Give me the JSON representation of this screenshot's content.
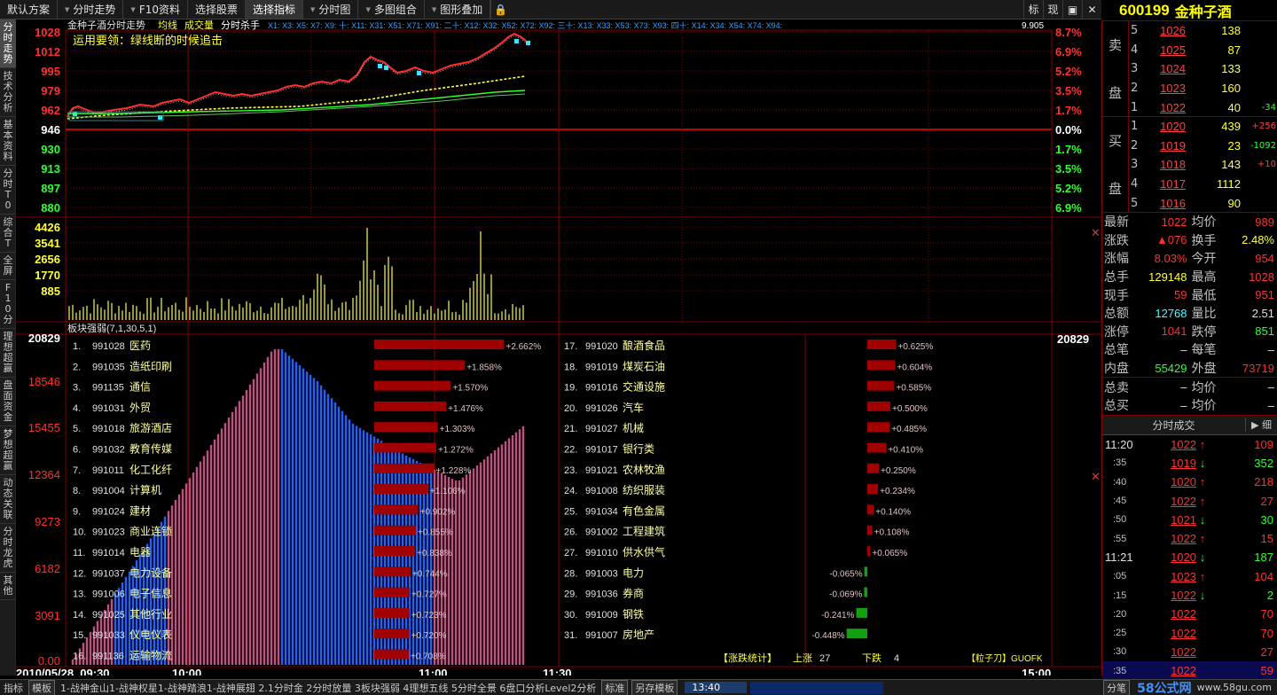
{
  "toolbar": {
    "items": [
      "默认方案",
      "分时走势",
      "F10资料",
      "选择股票",
      "选择指标",
      "分时图",
      "多图组合",
      "图形叠加"
    ],
    "right_buttons": [
      "标",
      "现",
      "",
      ""
    ]
  },
  "stock": {
    "code": "600199",
    "name": "金种子酒"
  },
  "left_tabs": [
    "分时走势",
    "技术分析",
    "基本资料",
    "分时T0",
    "综合T",
    "全屏",
    "F10分",
    "理想超赢",
    "盘面资金",
    "梦想超赢",
    "动态关联",
    "分时龙虎",
    "其他"
  ],
  "intraday": {
    "title": "金种子酒分时走势",
    "indicators": [
      "均线",
      "成交量",
      "分时杀手"
    ],
    "ma_legend": "X1: X3: X5: X7: X9: 十: X11: X31: X51: X71: X91: 二十: X12: X32: X52: X72: X92: 三十: X13: X33: X53: X73: X93: 四十: X14: X34: X54: X74: X94:",
    "last_value": "9.905",
    "note": "运用要领：绿线断的时候追击",
    "price_left": [
      "1028",
      "1012",
      "995",
      "979",
      "962",
      "946",
      "930",
      "913",
      "897",
      "880"
    ],
    "pct_right": [
      "8.7%",
      "6.9%",
      "5.2%",
      "3.5%",
      "1.7%",
      "0.0%",
      "1.7%",
      "3.5%",
      "5.2%",
      "6.9%"
    ],
    "vol_left": [
      "4426",
      "3541",
      "2656",
      "1770",
      "885"
    ]
  },
  "sector": {
    "header": "板块强弱(7,1,30,5,1)",
    "scale_left": [
      "20829",
      "18546",
      "15455",
      "12364",
      "9273",
      "6182",
      "3091",
      "0.00"
    ],
    "scale_right": "20829",
    "items_left": [
      {
        "rank": "1.",
        "code": "991028",
        "name": "医药",
        "pct": "+2.662%",
        "v": 2.662
      },
      {
        "rank": "2.",
        "code": "991035",
        "name": "造纸印刷",
        "pct": "+1.858%",
        "v": 1.858
      },
      {
        "rank": "3.",
        "code": "991135",
        "name": "通信",
        "pct": "+1.570%",
        "v": 1.57
      },
      {
        "rank": "4.",
        "code": "991031",
        "name": "外贸",
        "pct": "+1.476%",
        "v": 1.476
      },
      {
        "rank": "5.",
        "code": "991018",
        "name": "旅游酒店",
        "pct": "+1.303%",
        "v": 1.303
      },
      {
        "rank": "6.",
        "code": "991032",
        "name": "教育传媒",
        "pct": "+1.272%",
        "v": 1.272
      },
      {
        "rank": "7.",
        "code": "991011",
        "name": "化工化纤",
        "pct": "+1.228%",
        "v": 1.228
      },
      {
        "rank": "8.",
        "code": "991004",
        "name": "计算机",
        "pct": "+1.106%",
        "v": 1.106
      },
      {
        "rank": "9.",
        "code": "991024",
        "name": "建材",
        "pct": "+0.902%",
        "v": 0.902
      },
      {
        "rank": "10.",
        "code": "991023",
        "name": "商业连锁",
        "pct": "+0.855%",
        "v": 0.855
      },
      {
        "rank": "11.",
        "code": "991014",
        "name": "电器",
        "pct": "+0.838%",
        "v": 0.838
      },
      {
        "rank": "12.",
        "code": "991037",
        "name": "电力设备",
        "pct": "+0.744%",
        "v": 0.744
      },
      {
        "rank": "13.",
        "code": "991006",
        "name": "电子信息",
        "pct": "+0.727%",
        "v": 0.727
      },
      {
        "rank": "14.",
        "code": "991025",
        "name": "其他行业",
        "pct": "+0.723%",
        "v": 0.723
      },
      {
        "rank": "15.",
        "code": "991033",
        "name": "仪电仪表",
        "pct": "+0.720%",
        "v": 0.72
      },
      {
        "rank": "16.",
        "code": "991136",
        "name": "运输物流",
        "pct": "+0.708%",
        "v": 0.708
      }
    ],
    "items_right": [
      {
        "rank": "17.",
        "code": "991020",
        "name": "酿酒食品",
        "pct": "+0.625%",
        "v": 0.625
      },
      {
        "rank": "18.",
        "code": "991019",
        "name": "煤炭石油",
        "pct": "+0.604%",
        "v": 0.604
      },
      {
        "rank": "19.",
        "code": "991016",
        "name": "交通设施",
        "pct": "+0.585%",
        "v": 0.585
      },
      {
        "rank": "20.",
        "code": "991026",
        "name": "汽车",
        "pct": "+0.500%",
        "v": 0.5
      },
      {
        "rank": "21.",
        "code": "991027",
        "name": "机械",
        "pct": "+0.485%",
        "v": 0.485
      },
      {
        "rank": "22.",
        "code": "991017",
        "name": "银行类",
        "pct": "+0.410%",
        "v": 0.41
      },
      {
        "rank": "23.",
        "code": "991021",
        "name": "农林牧渔",
        "pct": "+0.250%",
        "v": 0.25
      },
      {
        "rank": "24.",
        "code": "991008",
        "name": "纺织服装",
        "pct": "+0.234%",
        "v": 0.234
      },
      {
        "rank": "25.",
        "code": "991034",
        "name": "有色金属",
        "pct": "+0.140%",
        "v": 0.14
      },
      {
        "rank": "26.",
        "code": "991002",
        "name": "工程建筑",
        "pct": "+0.108%",
        "v": 0.108
      },
      {
        "rank": "27.",
        "code": "991010",
        "name": "供水供气",
        "pct": "+0.065%",
        "v": 0.065
      },
      {
        "rank": "28.",
        "code": "991003",
        "name": "电力",
        "pct": "-0.065%",
        "v": -0.065
      },
      {
        "rank": "29.",
        "code": "991036",
        "name": "券商",
        "pct": "-0.069%",
        "v": -0.069
      },
      {
        "rank": "30.",
        "code": "991009",
        "name": "钢铁",
        "pct": "-0.241%",
        "v": -0.241
      },
      {
        "rank": "31.",
        "code": "991007",
        "name": "房地产",
        "pct": "-0.448%",
        "v": -0.448
      }
    ],
    "stats_label": "【涨跌统计】",
    "up_label": "上涨",
    "up_count": "27",
    "down_label": "下跌",
    "down_count": "4",
    "brand_label": "【粒子刀】GUOFK"
  },
  "time_axis": {
    "date": "2010/05/28, 09:30",
    "ticks": [
      "10:00",
      "11:00",
      "11:30",
      "15:00"
    ]
  },
  "orderbook": {
    "ask_label": [
      "卖",
      "盘"
    ],
    "bid_label": [
      "买",
      "盘"
    ],
    "asks": [
      {
        "lvl": "5",
        "price": "1026",
        "vol": "138",
        "chg": ""
      },
      {
        "lvl": "4",
        "price": "1025",
        "vol": "87",
        "chg": ""
      },
      {
        "lvl": "3",
        "price": "1024",
        "vol": "133",
        "chg": ""
      },
      {
        "lvl": "2",
        "price": "1023",
        "vol": "160",
        "chg": ""
      },
      {
        "lvl": "1",
        "price": "1022",
        "vol": "40",
        "chg": "-34"
      }
    ],
    "bids": [
      {
        "lvl": "1",
        "price": "1020",
        "vol": "439",
        "chg": "+256"
      },
      {
        "lvl": "2",
        "price": "1019",
        "vol": "23",
        "chg": "-1092"
      },
      {
        "lvl": "3",
        "price": "1018",
        "vol": "143",
        "chg": "+10"
      },
      {
        "lvl": "4",
        "price": "1017",
        "vol": "1112",
        "chg": ""
      },
      {
        "lvl": "5",
        "price": "1016",
        "vol": "90",
        "chg": ""
      }
    ]
  },
  "quote": [
    {
      "k1": "最新",
      "v1": "1022",
      "c1": "red",
      "k2": "均价",
      "v2": "989",
      "c2": "red"
    },
    {
      "k1": "涨跌",
      "v1": "▲076",
      "c1": "red",
      "k2": "换手",
      "v2": "2.48%",
      "c2": "yel"
    },
    {
      "k1": "涨幅",
      "v1": "8.03%",
      "c1": "red",
      "k2": "今开",
      "v2": "954",
      "c2": "red"
    },
    {
      "k1": "总手",
      "v1": "129148",
      "c1": "yel",
      "k2": "最高",
      "v2": "1028",
      "c2": "red"
    },
    {
      "k1": "现手",
      "v1": "59",
      "c1": "red",
      "k2": "最低",
      "v2": "951",
      "c2": "red"
    },
    {
      "k1": "总额",
      "v1": "12768",
      "c1": "cyan",
      "k2": "量比",
      "v2": "2.51",
      "c2": "wht"
    },
    {
      "k1": "涨停",
      "v1": "1041",
      "c1": "red",
      "k2": "跌停",
      "v2": "851",
      "c2": "grn"
    },
    {
      "k1": "总笔",
      "v1": "–",
      "c1": "wht",
      "k2": "每笔",
      "v2": "–",
      "c2": "wht"
    },
    {
      "k1": "内盘",
      "v1": "55429",
      "c1": "grn",
      "k2": "外盘",
      "v2": "73719",
      "c2": "red"
    }
  ],
  "quote2": [
    {
      "k1": "总卖",
      "v1": "–",
      "k2": "均价",
      "v2": "–"
    },
    {
      "k1": "总买",
      "v1": "–",
      "k2": "均价",
      "v2": "–"
    }
  ],
  "ticks": {
    "title": "分时成交",
    "detail": "细",
    "rows": [
      {
        "time": "11:20",
        "sub": false,
        "price": "1022",
        "dir": "up",
        "vol": "109"
      },
      {
        "time": ":35",
        "sub": true,
        "price": "1019",
        "dir": "down",
        "vol": "352"
      },
      {
        "time": ":40",
        "sub": true,
        "price": "1020",
        "dir": "up",
        "vol": "218"
      },
      {
        "time": ":45",
        "sub": true,
        "price": "1022",
        "dir": "up",
        "vol": "27"
      },
      {
        "time": ":50",
        "sub": true,
        "price": "1021",
        "dir": "down",
        "vol": "30"
      },
      {
        "time": ":55",
        "sub": true,
        "price": "1022",
        "dir": "up",
        "vol": "15"
      },
      {
        "time": "11:21",
        "sub": false,
        "price": "1020",
        "dir": "down",
        "vol": "187"
      },
      {
        "time": ":05",
        "sub": true,
        "price": "1023",
        "dir": "up",
        "vol": "104"
      },
      {
        "time": ":15",
        "sub": true,
        "price": "1022",
        "dir": "down",
        "vol": "2"
      },
      {
        "time": ":20",
        "sub": true,
        "price": "1022",
        "dir": "",
        "vol": "70"
      },
      {
        "time": ":25",
        "sub": true,
        "price": "1022",
        "dir": "",
        "vol": "70"
      },
      {
        "time": ":30",
        "sub": true,
        "price": "1022",
        "dir": "",
        "vol": "27"
      },
      {
        "time": ":35",
        "sub": true,
        "price": "1022",
        "dir": "",
        "vol": "59"
      }
    ]
  },
  "statusbar": {
    "label": "指标",
    "mode": "模板",
    "text": "1-战神金山1-战神权星1-战神踏浪1-战神展翅 2.1分时金 2分时放量 3板块强弱 4理想五线 5分时全景 6盘口分析Level2分析",
    "standard": "标准",
    "save": "另存模板",
    "time": "13:40",
    "split": "分笔",
    "brand": "58公式网",
    "url": "www.58gu.com"
  },
  "colors": {
    "up": "#ff3030",
    "down": "#30ff30",
    "grid": "#800000",
    "accent": "#ffff40"
  }
}
